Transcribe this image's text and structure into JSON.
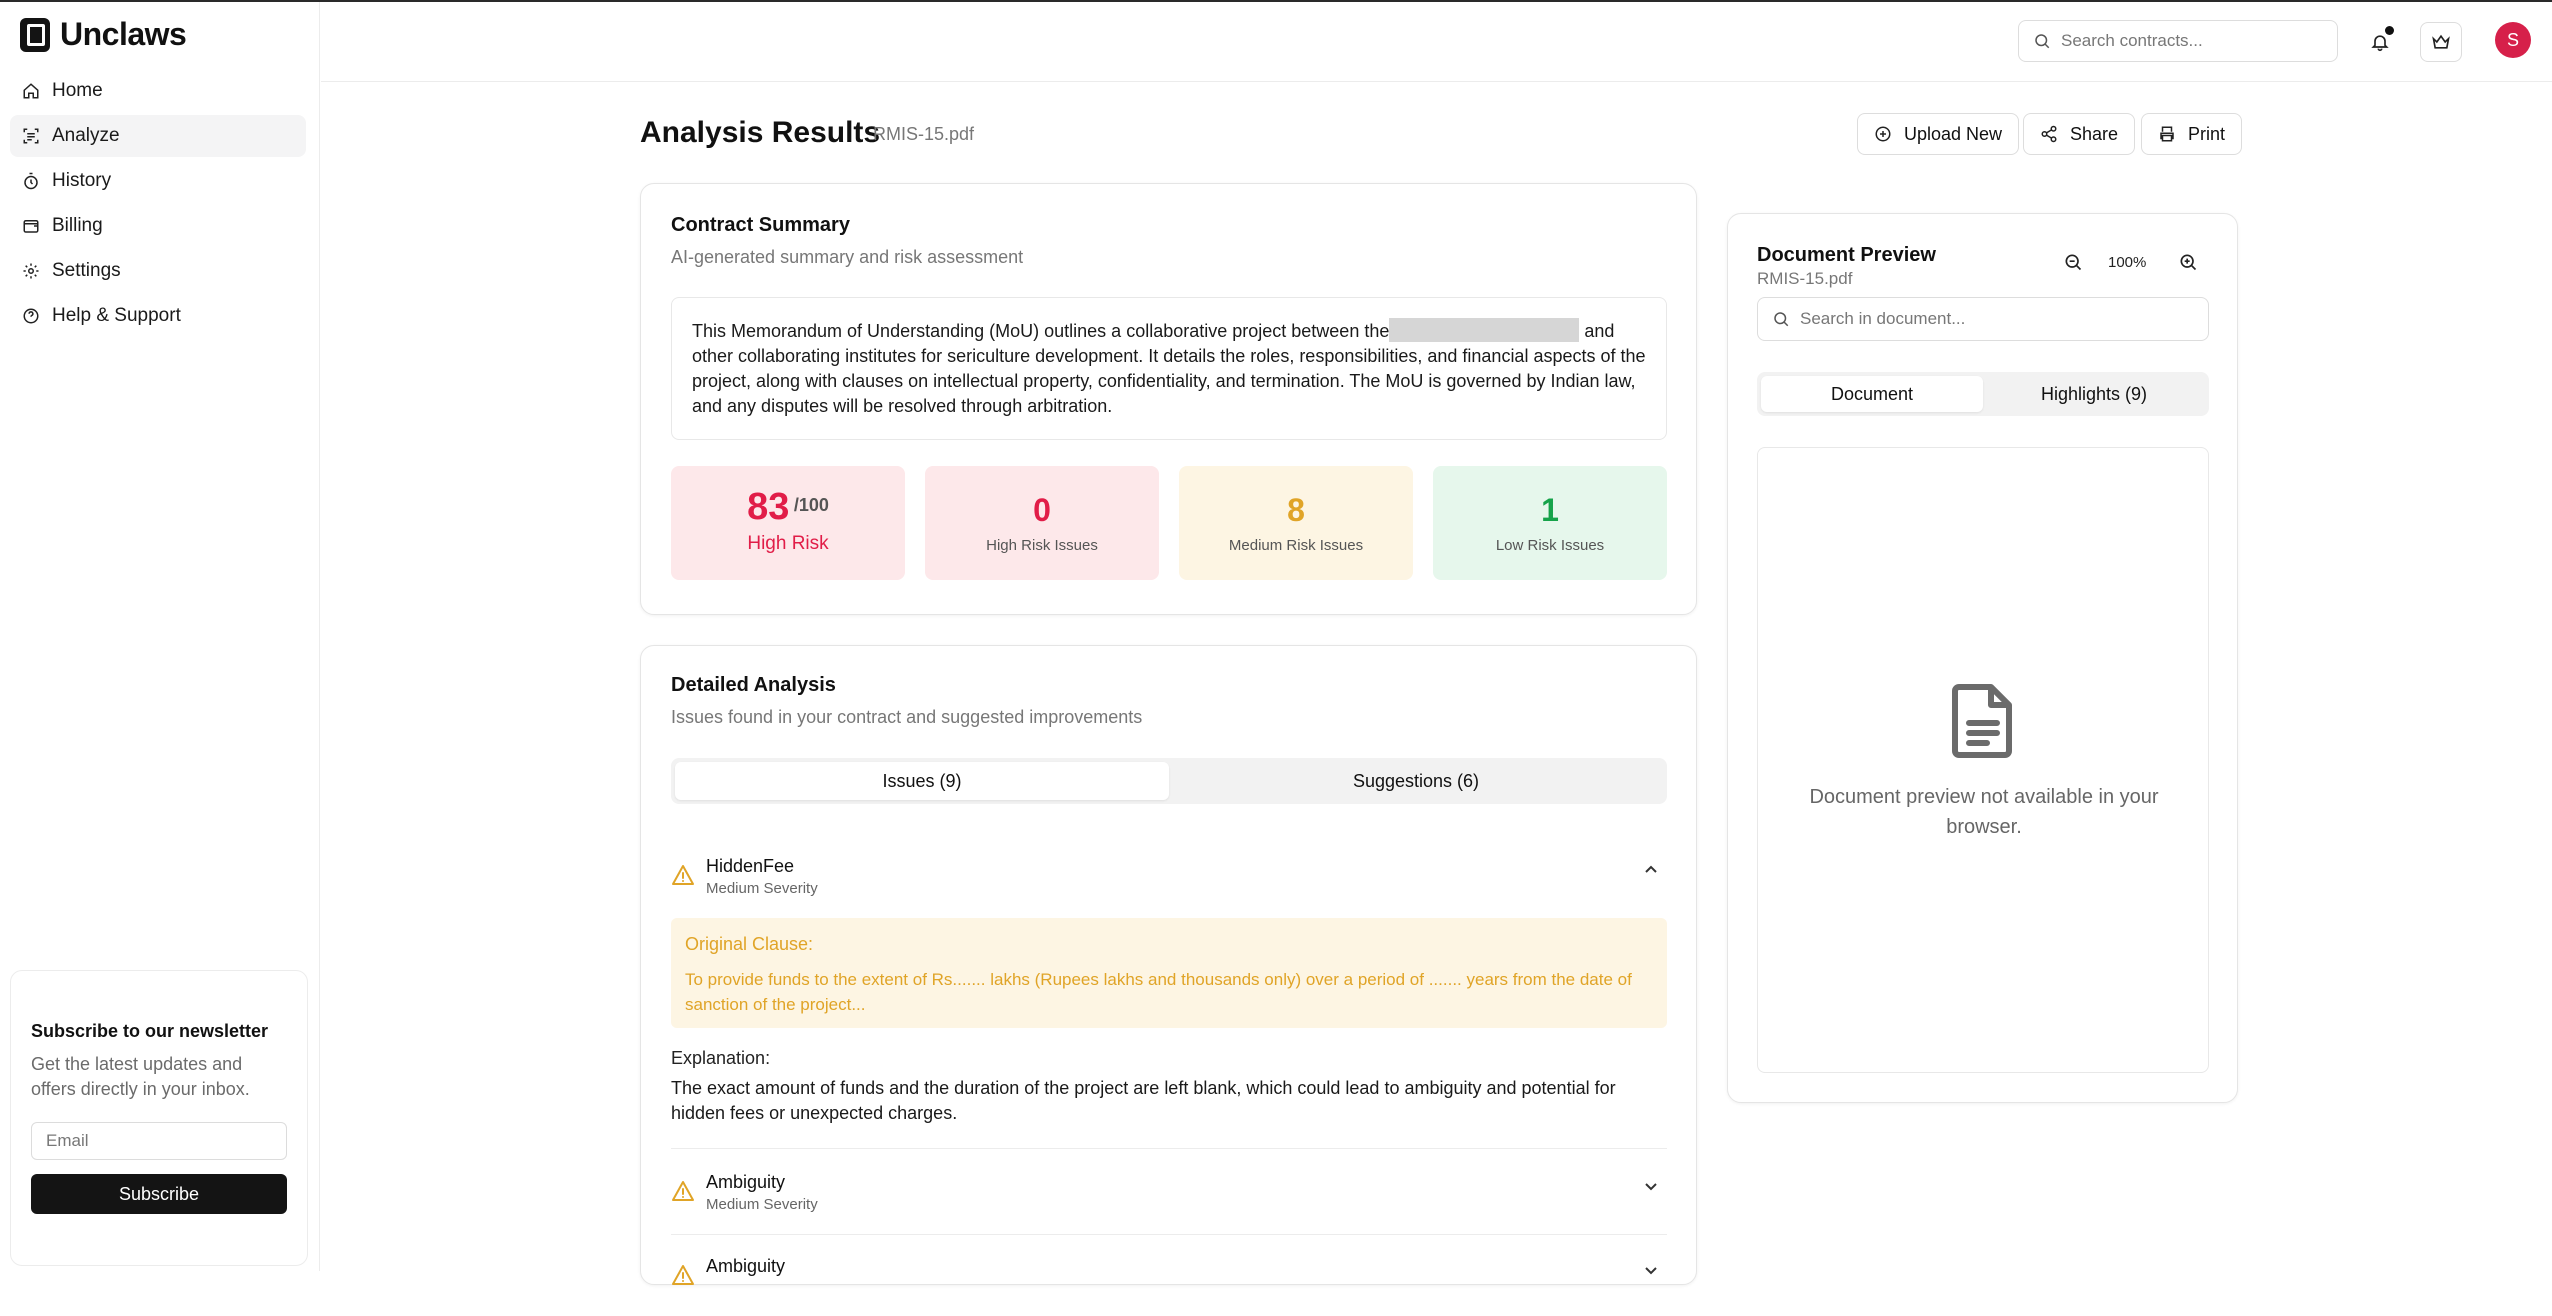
{
  "brand": {
    "name": "Unclaws"
  },
  "sidebar": {
    "items": [
      {
        "label": "Home",
        "icon": "home-icon"
      },
      {
        "label": "Analyze",
        "icon": "scan-icon",
        "active": true
      },
      {
        "label": "History",
        "icon": "timer-icon"
      },
      {
        "label": "Billing",
        "icon": "wallet-icon"
      },
      {
        "label": "Settings",
        "icon": "gear-icon"
      },
      {
        "label": "Help & Support",
        "icon": "help-icon"
      }
    ],
    "newsletter": {
      "title": "Subscribe to our newsletter",
      "description": "Get the latest updates and offers directly in your inbox.",
      "email_placeholder": "Email",
      "button_label": "Subscribe"
    }
  },
  "header": {
    "search_placeholder": "Search contracts...",
    "avatar_initial": "S"
  },
  "page": {
    "title": "Analysis Results",
    "file_name": "RMIS-15.pdf",
    "actions": {
      "upload": "Upload New",
      "share": "Share",
      "print": "Print"
    }
  },
  "summary": {
    "title": "Contract Summary",
    "subtitle": "AI-generated summary and risk assessment",
    "text_before_redaction": "This Memorandum of Understanding (MoU) outlines a collaborative project between the",
    "text_after_redaction": "and other collaborating institutes for sericulture development. It details the roles, responsibilities, and financial aspects of the project, along with clauses on intellectual property, confidentiality, and termination. The MoU is governed by Indian law, and any disputes will be resolved through arbitration.",
    "score": "83",
    "score_max": "/100",
    "score_label": "High Risk",
    "stats": [
      {
        "value": "0",
        "label": "High Risk Issues",
        "color": "#e11d48",
        "bg": "#fde8ea"
      },
      {
        "value": "8",
        "label": "Medium Risk Issues",
        "color": "#e0a427",
        "bg": "#fdf5e3"
      },
      {
        "value": "1",
        "label": "Low Risk Issues",
        "color": "#16a34a",
        "bg": "#e6f7ec"
      }
    ]
  },
  "analysis": {
    "title": "Detailed Analysis",
    "subtitle": "Issues found in your contract and suggested improvements",
    "tabs": {
      "issues": "Issues (9)",
      "suggestions": "Suggestions (6)"
    },
    "issues": [
      {
        "name": "HiddenFee",
        "severity": "Medium Severity",
        "expanded": true,
        "clause_label": "Original Clause:",
        "clause_text": "To provide funds to the extent of Rs....... lakhs (Rupees lakhs and thousands only) over a period of ....... years from the date of sanction of the project...",
        "explanation_label": "Explanation:",
        "explanation_text": "The exact amount of funds and the duration of the project are left blank, which could lead to ambiguity and potential for hidden fees or unexpected charges."
      },
      {
        "name": "Ambiguity",
        "severity": "Medium Severity",
        "expanded": false
      },
      {
        "name": "Ambiguity",
        "severity": "",
        "expanded": false
      }
    ]
  },
  "preview": {
    "title": "Document Preview",
    "file_name": "RMIS-15.pdf",
    "zoom": "100%",
    "search_placeholder": "Search in document...",
    "tabs": {
      "document": "Document",
      "highlights": "Highlights (9)"
    },
    "message": "Document preview not available in your browser."
  },
  "colors": {
    "accent_dark": "#141414",
    "avatar": "#d6204a",
    "warning": "#e0a427",
    "danger": "#e11d48",
    "success": "#16a34a"
  }
}
